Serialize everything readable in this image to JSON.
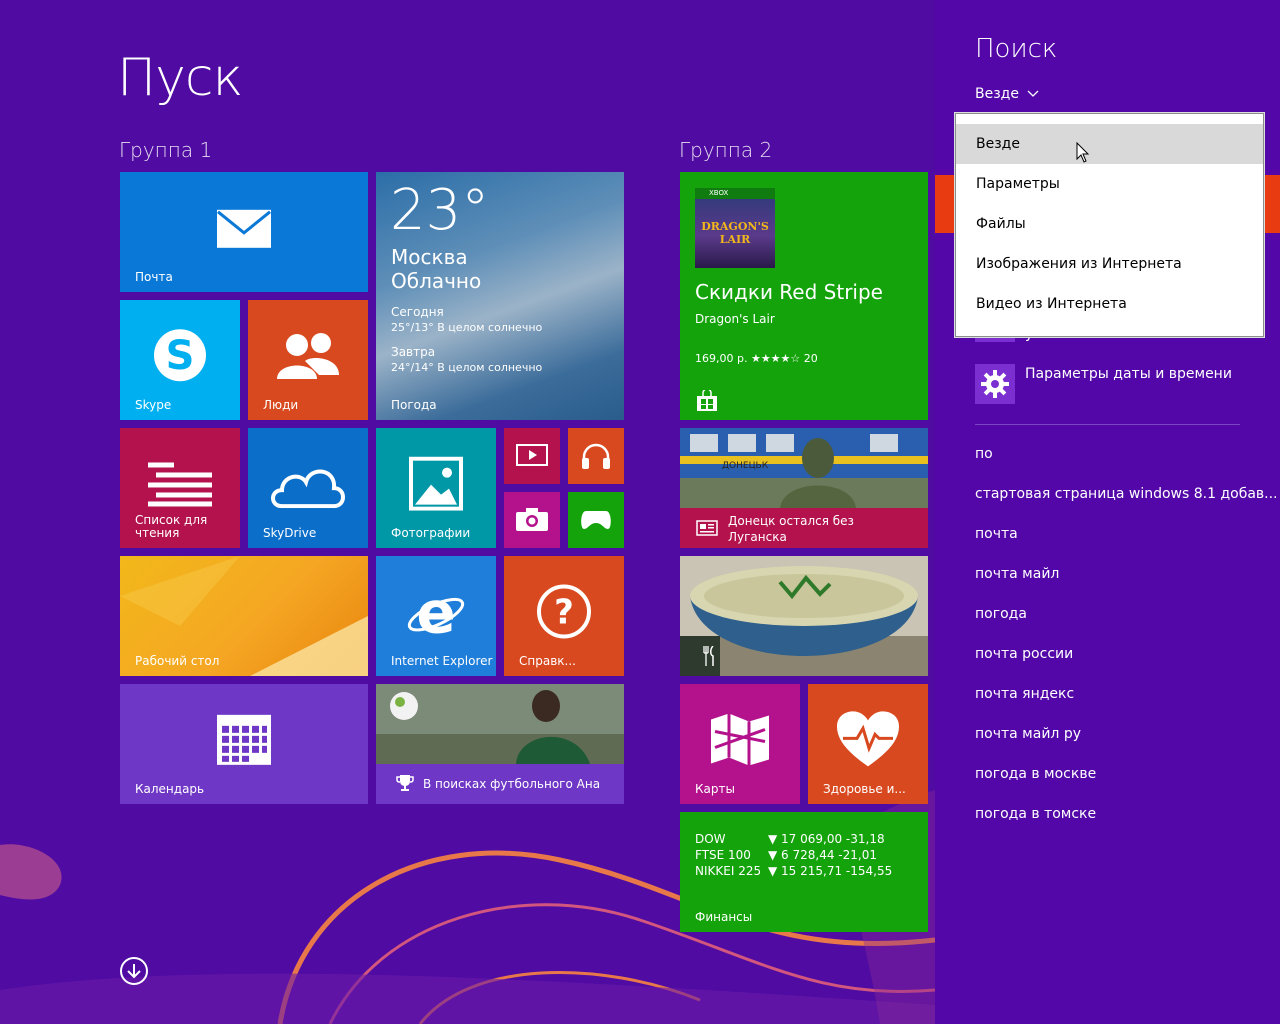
{
  "start": {
    "title": "Пуск"
  },
  "groups": [
    "Группа 1",
    "Группа 2"
  ],
  "tiles": {
    "mail": "Почта",
    "skype": "Skype",
    "people": "Люди",
    "weather": {
      "temp": "23°",
      "city": "Москва",
      "cond": "Облачно",
      "today": "Сегодня",
      "today_fc": "25°/13° В целом солнечно",
      "tomorrow": "Завтра",
      "tomorrow_fc": "24°/14° В целом солнечно",
      "label": "Погода"
    },
    "readlist": "Список для чтения",
    "skydrive": "SkyDrive",
    "photos": "Фотографии",
    "desktop": "Рабочий стол",
    "ie": "Internet Explorer",
    "help": "Справк...",
    "calendar": "Календарь",
    "sport": "В поисках футбольного Ана",
    "store": {
      "xbox": "XBOX",
      "title": "Скидки Red Stripe",
      "game": "Dragon's Lair",
      "price": "169,00 р. ★★★★☆ 20",
      "art_text": "DRAGON'S LAIR"
    },
    "news": "Донецк остался без Луганска",
    "news_sign": "ДОНЕЦЬК",
    "maps": "Карты",
    "health": "Здоровье и...",
    "finance": {
      "rows": [
        {
          "name": "DOW",
          "value": "▼ 17 069,00 -31,18"
        },
        {
          "name": "FTSE 100",
          "value": "▼ 6 728,44 -21,01"
        },
        {
          "name": "NIKKEI 225",
          "value": "▼ 15 215,71 -154,55"
        }
      ],
      "label": "Финансы"
    }
  },
  "search": {
    "title": "Поиск",
    "scope": "Везде",
    "dropdown": [
      "Везде",
      "Параметры",
      "Файлы",
      "Изображения из Интернета",
      "Видео из Интернета"
    ],
    "partial_result": "умолчанию",
    "result_datetime": "Параметры даты и времени",
    "suggestions": [
      "по",
      "стартовая страница windows 8.1 добав...",
      "почта",
      "почта майл",
      "погода",
      "почта россии",
      "почта яндекс",
      "почта майл ру",
      "погода в москве",
      "погода в томске"
    ]
  },
  "colors": {
    "background": "#4f0ba2",
    "search_pane": "#5307a8",
    "accent_orange": "#e83b12"
  }
}
